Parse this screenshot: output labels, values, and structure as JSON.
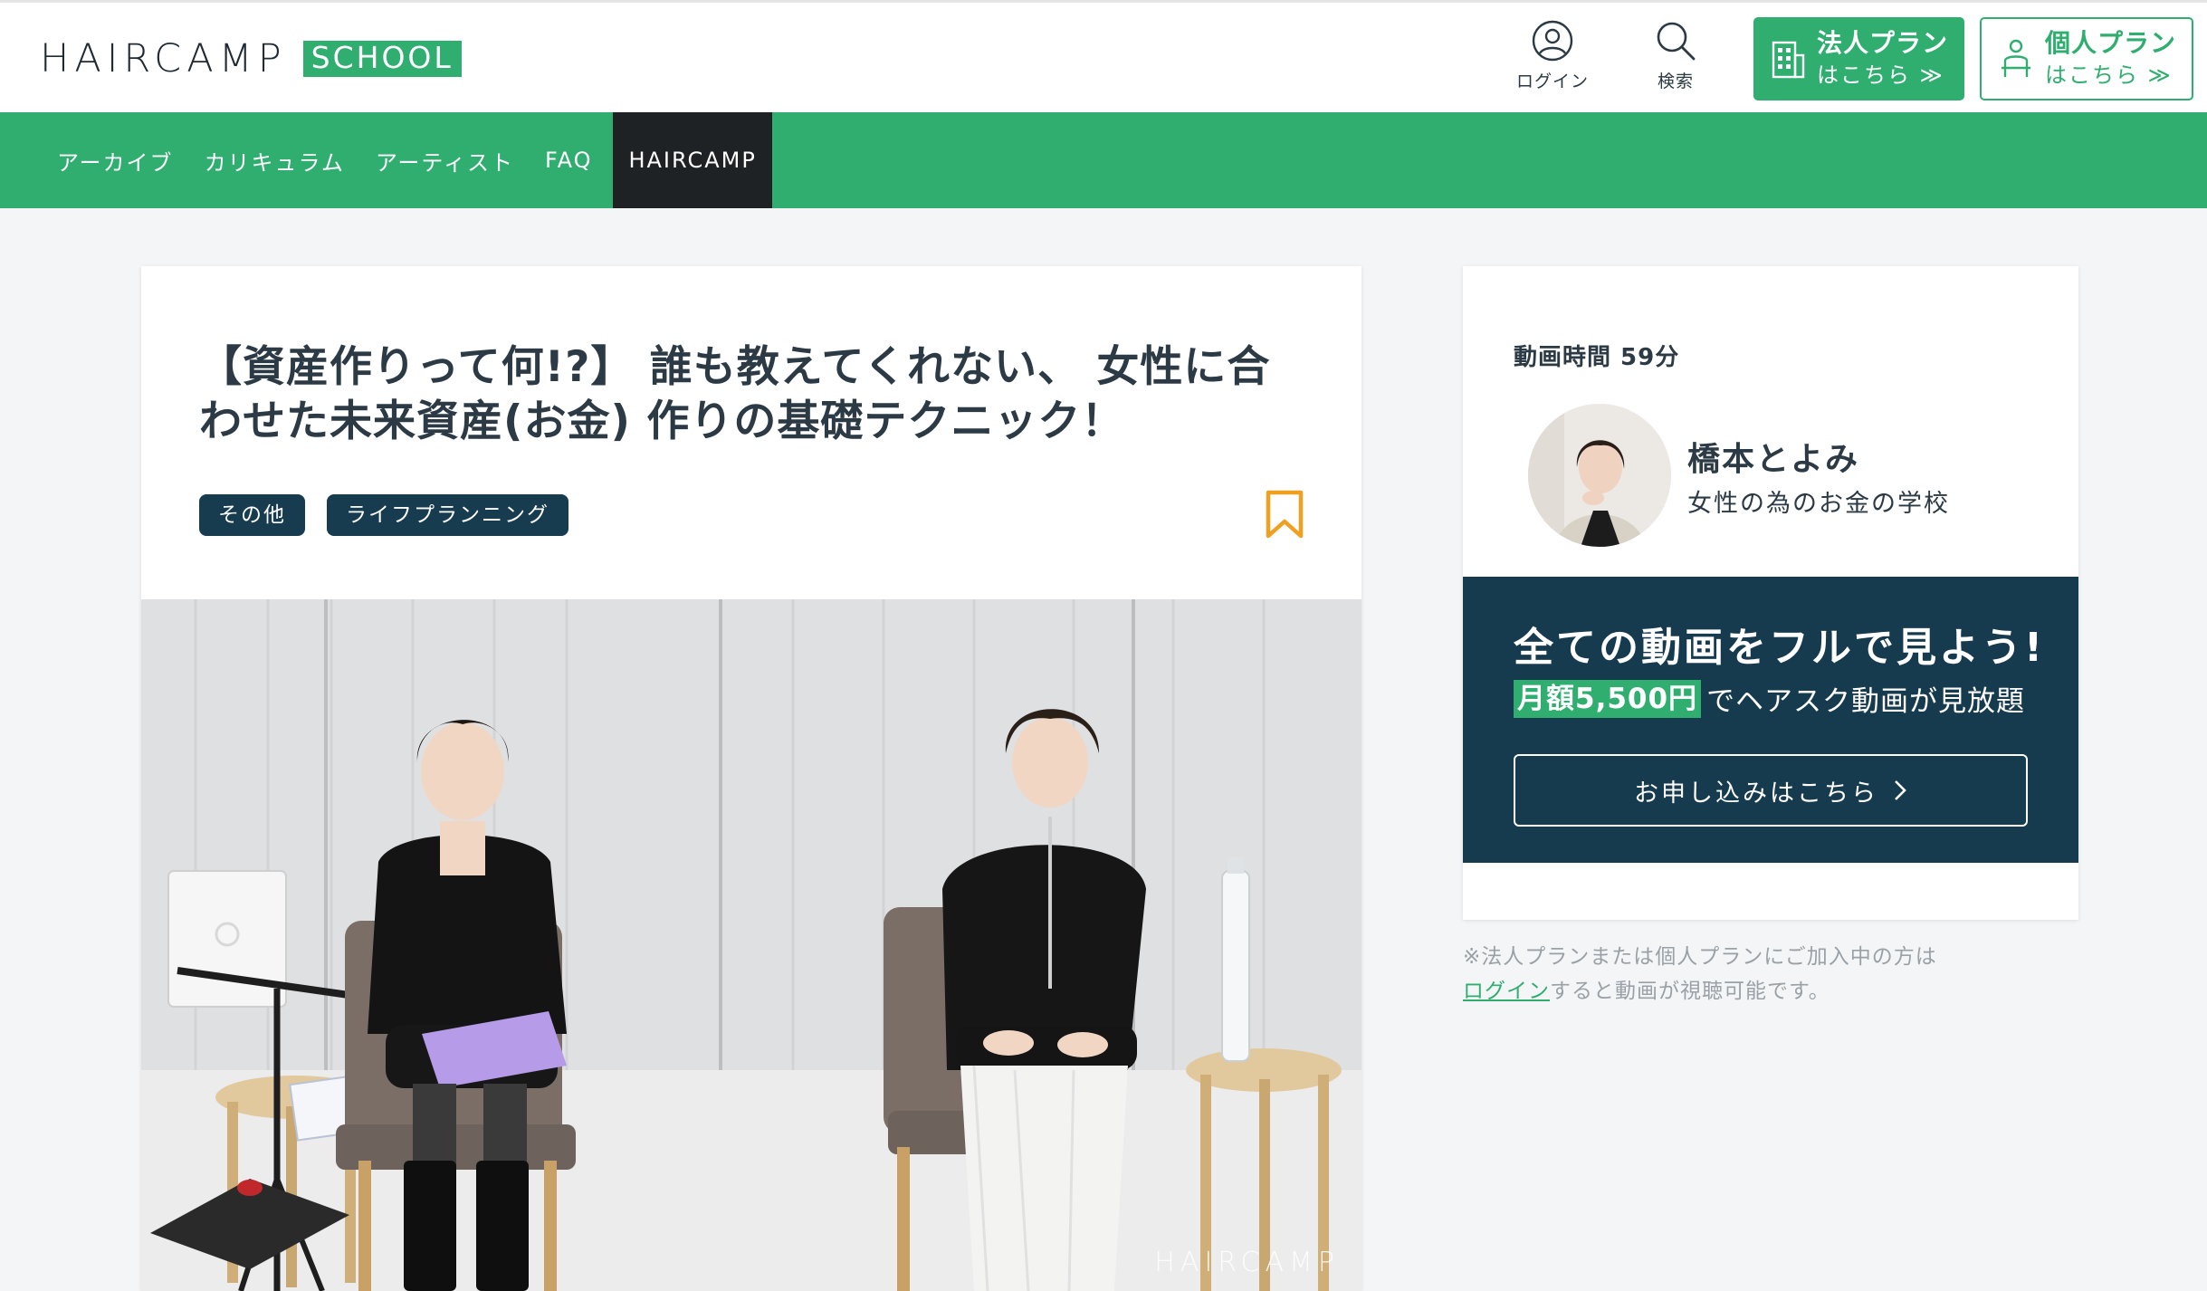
{
  "header": {
    "logo_main": "HAIRCAMP",
    "logo_badge": "SCHOOL",
    "login_label": "ログイン",
    "search_label": "検索",
    "corp_plan": {
      "main": "法人プラン",
      "sub": "はこちら ≫"
    },
    "indiv_plan": {
      "main": "個人プラン",
      "sub": "はこちら ≫"
    }
  },
  "nav": {
    "items": [
      {
        "label": "アーカイブ"
      },
      {
        "label": "カリキュラム"
      },
      {
        "label": "アーティスト"
      },
      {
        "label": "FAQ"
      },
      {
        "label": "HAIRCAMP",
        "active": true
      }
    ]
  },
  "article": {
    "title": "【資産作りって何!?】 誰も教えてくれない、 女性に合わせた未来資産(お金) 作りの基礎テクニック！",
    "tags": [
      "その他",
      "ライフプランニング"
    ],
    "video_watermark": "HAIRCAMP"
  },
  "sidebar": {
    "duration": "動画時間 59分",
    "artist_name": "橋本とよみ",
    "artist_desc": "女性の為のお金の学校",
    "promo_head": "全ての動画をフルで見よう!",
    "promo_price": "月額5,500円",
    "promo_rest": "でヘアスク動画が見放題",
    "promo_button": "お申し込みはこちら",
    "note_line1": "※法人プランまたは個人プランにご加入中の方は",
    "note_link": "ログイン",
    "note_rest": "すると動画が視聴可能です。"
  },
  "colors": {
    "brand_green": "#2fae6f",
    "navy": "#163a4e",
    "bookmark_orange": "#f0a020",
    "nav_active": "#1f2224"
  }
}
